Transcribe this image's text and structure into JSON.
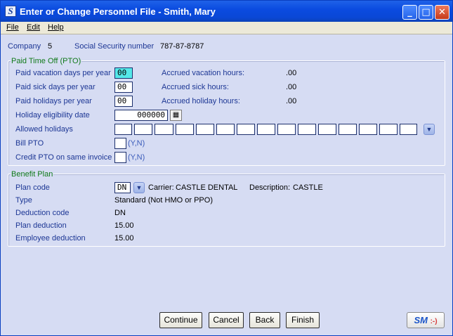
{
  "window": {
    "title": "Enter or Change Personnel File - Smith, Mary",
    "app_icon_letter": "S"
  },
  "titlebar_buttons": {
    "minimize": "_",
    "maximize": "□",
    "close": "✕"
  },
  "menu": {
    "file": "File",
    "edit": "Edit",
    "help": "Help"
  },
  "header": {
    "company_label": "Company",
    "company_value": "5",
    "ssn_label": "Social Security number",
    "ssn_value": "787-87-8787"
  },
  "pto": {
    "title": "Paid Time Off (PTO)",
    "vacation_days_label": "Paid vacation days per year",
    "vacation_days_value": "00",
    "sick_days_label": "Paid sick days per year",
    "sick_days_value": "00",
    "holidays_label": "Paid holidays per year",
    "holidays_value": "00",
    "eligibility_label": "Holiday eligibility date",
    "eligibility_value": "000000",
    "allowed_holidays_label": "Allowed holidays",
    "bill_pto_label": "Bill PTO",
    "bill_pto_hint": "(Y,N)",
    "credit_pto_label": "Credit PTO on same invoice",
    "credit_pto_hint": "(Y,N)",
    "accrued_vacation_label": "Accrued vacation hours:",
    "accrued_vacation_value": ".00",
    "accrued_sick_label": "Accrued sick hours:",
    "accrued_sick_value": ".00",
    "accrued_holiday_label": "Accrued holiday hours:",
    "accrued_holiday_value": ".00"
  },
  "benefit": {
    "title": "Benefit Plan",
    "plan_code_label": "Plan code",
    "plan_code_value": "DN",
    "carrier_label": "Carrier:",
    "carrier_value": "CASTLE DENTAL",
    "description_label": "Description:",
    "description_value": "CASTLE",
    "type_label": "Type",
    "type_value": "Standard (Not HMO or PPO)",
    "deduction_code_label": "Deduction code",
    "deduction_code_value": "DN",
    "plan_deduction_label": "Plan deduction",
    "plan_deduction_value": "15.00",
    "employee_deduction_label": "Employee deduction",
    "employee_deduction_value": "15.00"
  },
  "buttons": {
    "continue": "Continue",
    "cancel": "Cancel",
    "back": "Back",
    "finish": "Finish"
  },
  "badge": {
    "text": "SM",
    "smile": ":-)"
  },
  "icons": {
    "dropdown": "chevron-down-icon",
    "calendar": "calendar-icon"
  }
}
